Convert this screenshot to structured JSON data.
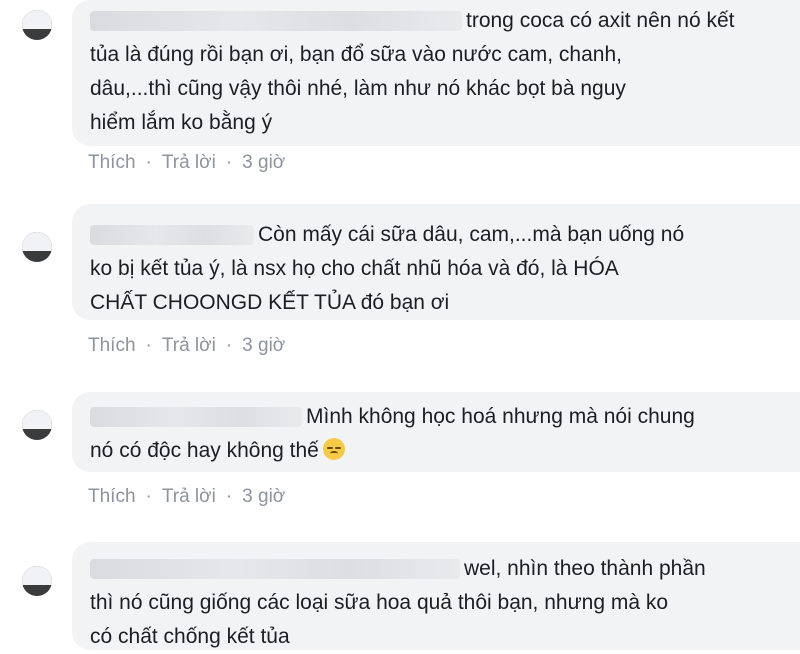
{
  "comments": [
    {
      "lines": [
        "trong coca có axit nên nó kết",
        "tủa là đúng rồi bạn ơi, bạn đổ sữa vào nước cam, chanh,",
        "dâu,...thì cũng vậy thôi nhé, làm như nó khác bọt bà nguy",
        "hiểm lắm ko bằng ý"
      ],
      "actions": {
        "like": "Thích",
        "reply": "Trả lời",
        "time": "3 giờ"
      }
    },
    {
      "lines": [
        "Còn mấy cái sữa dâu, cam,...mà bạn uống nó",
        "ko bị kết tủa ý, là nsx họ cho chất nhũ hóa và đó, là HÓA",
        "CHẤT CHOONGD KẾT TỦA đó bạn ơi"
      ],
      "actions": {
        "like": "Thích",
        "reply": "Trả lời",
        "time": "3 giờ"
      }
    },
    {
      "lines": [
        "Mình không học hoá nhưng mà nói chung",
        "nó có độc hay không thế"
      ],
      "emoji": "disappointed-face",
      "actions": {
        "like": "Thích",
        "reply": "Trả lời",
        "time": "3 giờ"
      }
    },
    {
      "lines": [
        "wel, nhìn theo thành phần",
        "thì nó cũng giống các loại sữa hoa quả thôi bạn, nhưng mà ko",
        "có chất chống kết tủa"
      ]
    }
  ],
  "colors": {
    "bubble": "#f2f3f5",
    "meta": "#8d949e",
    "text": "#1c1e21"
  }
}
